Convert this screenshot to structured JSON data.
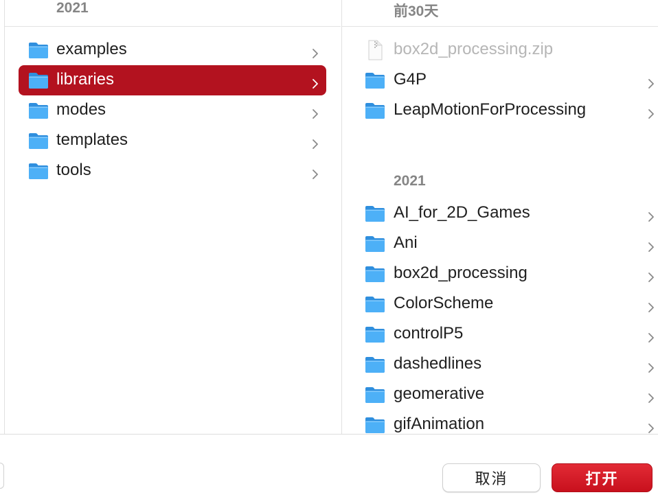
{
  "column1": {
    "header": "2021",
    "items": [
      {
        "label": "examples",
        "kind": "folder",
        "selected": false
      },
      {
        "label": "libraries",
        "kind": "folder",
        "selected": true
      },
      {
        "label": "modes",
        "kind": "folder",
        "selected": false
      },
      {
        "label": "templates",
        "kind": "folder",
        "selected": false
      },
      {
        "label": "tools",
        "kind": "folder",
        "selected": false
      }
    ]
  },
  "column2": {
    "groups": [
      {
        "header": "前30天",
        "items": [
          {
            "label": "box2d_processing.zip",
            "kind": "file",
            "disabled": true
          },
          {
            "label": "G4P",
            "kind": "folder"
          },
          {
            "label": "LeapMotionForProcessing",
            "kind": "folder"
          }
        ]
      },
      {
        "header": "2021",
        "items": [
          {
            "label": "AI_for_2D_Games",
            "kind": "folder"
          },
          {
            "label": "Ani",
            "kind": "folder"
          },
          {
            "label": "box2d_processing",
            "kind": "folder"
          },
          {
            "label": "ColorScheme",
            "kind": "folder"
          },
          {
            "label": "controlP5",
            "kind": "folder"
          },
          {
            "label": "dashedlines",
            "kind": "folder"
          },
          {
            "label": "geomerative",
            "kind": "folder"
          },
          {
            "label": "gifAnimation",
            "kind": "folder"
          }
        ]
      }
    ]
  },
  "footer": {
    "cancel_label": "取消",
    "open_label": "打开"
  },
  "colors": {
    "selection": "#b3121f",
    "folder_blue": "#3aa0f0",
    "accent_button": "#d11a26"
  },
  "icons": {
    "folder": "folder-icon",
    "file": "zip-file-icon",
    "chevron": "chevron-right-icon"
  }
}
